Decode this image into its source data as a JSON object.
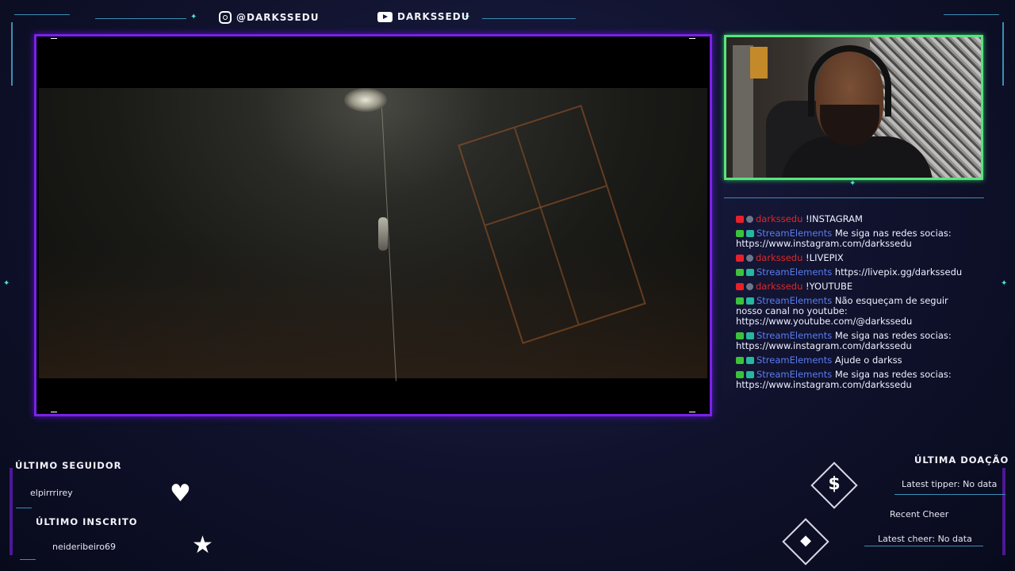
{
  "social": {
    "instagram": "@DARKSSEDU",
    "youtube": "DARKSSEDU"
  },
  "chat": {
    "messages": [
      {
        "user": "darkssedu",
        "text": "!INSTAGRAM",
        "type": "streamer"
      },
      {
        "user": "StreamElements",
        "text": "Me siga nas redes socias: https://www.instagram.com/darkssedu",
        "type": "bot"
      },
      {
        "user": "darkssedu",
        "text": "!LIVEPIX",
        "type": "streamer"
      },
      {
        "user": "StreamElements",
        "text": "https://livepix.gg/darkssedu",
        "type": "bot"
      },
      {
        "user": "darkssedu",
        "text": "!YOUTUBE",
        "type": "streamer"
      },
      {
        "user": "StreamElements",
        "text": "Não esqueçam de seguir nosso canal no youtube: https://www.youtube.com/@darkssedu",
        "type": "bot"
      },
      {
        "user": "StreamElements",
        "text": "Me siga nas redes socias: https://www.instagram.com/darkssedu",
        "type": "bot"
      },
      {
        "user": "StreamElements",
        "text": "Ajude o darkss",
        "type": "bot"
      },
      {
        "user": "StreamElements",
        "text": "Me siga nas redes socias: https://www.instagram.com/darkssedu",
        "type": "bot"
      }
    ]
  },
  "widgets": {
    "last_follower_label": "ÚLTIMO SEGUIDOR",
    "last_follower_value": "elpirrrirey",
    "last_sub_label": "ÚLTIMO INSCRITO",
    "last_sub_value": "neideribeiro69",
    "last_donation_label": "ÚLTIMA DOAÇÃO",
    "latest_tipper": "Latest tipper: No data",
    "recent_cheer_label": "Recent Cheer",
    "latest_cheer": "Latest cheer: No data"
  },
  "icons": {
    "follower": "heart-icon",
    "sub": "star-icon",
    "donation": "dollar-icon",
    "cheer": "gem-icon"
  },
  "colors": {
    "game_border": "#7a22e8",
    "cam_border": "#5be37d",
    "streamer_name": "#e02828",
    "bot_name": "#5a7cf0",
    "neon_line": "#3b8fb4"
  }
}
